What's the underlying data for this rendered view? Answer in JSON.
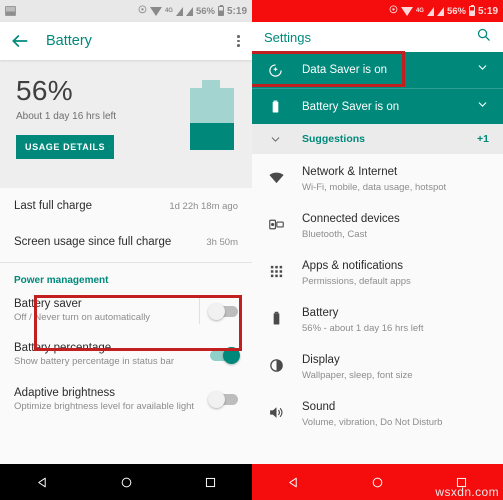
{
  "colors": {
    "teal": "#00897a",
    "teal_light": "#a4d4d0",
    "status_red": "#f50c0c",
    "annotation_red": "#c21f20"
  },
  "left_screen": {
    "statusbar": {
      "icons": [
        "screenshot-icon",
        "dnd-icon",
        "wifi-icon",
        "4g-label",
        "signal-icon",
        "signal-icon"
      ],
      "network_label": "4G",
      "battery_percent": "56%",
      "clock": "5:19"
    },
    "appbar": {
      "back_icon": "back-arrow-icon",
      "title": "Battery",
      "overflow_icon": "kebab-menu-icon"
    },
    "hero": {
      "percent": "56%",
      "estimate": "About 1 day 16 hrs left",
      "button_label": "USAGE DETAILS",
      "battery_fill_percent": 44
    },
    "rows": [
      {
        "title": "Last full charge",
        "value": "1d 22h 18m ago"
      },
      {
        "title": "Screen usage since full charge",
        "value": "3h 50m"
      }
    ],
    "section_title": "Power management",
    "settings": [
      {
        "title": "Battery saver",
        "subtitle": "Off / Never turn on automatically",
        "toggle": "off",
        "highlighted": true
      },
      {
        "title": "Battery percentage",
        "subtitle": "Show battery percentage in status bar",
        "toggle": "on",
        "highlighted": false
      },
      {
        "title": "Adaptive brightness",
        "subtitle": "Optimize brightness level for available light",
        "toggle": "off",
        "highlighted": false
      }
    ],
    "navbar": {
      "back": "back-triangle-icon",
      "home": "home-circle-icon",
      "recents": "recents-square-icon"
    }
  },
  "right_screen": {
    "statusbar": {
      "network_label": "4G",
      "battery_percent": "56%",
      "clock": "5:19"
    },
    "appbar": {
      "title": "Settings",
      "search_icon": "search-icon"
    },
    "banners": [
      {
        "icon": "data-saver-icon",
        "label": "Data Saver is on",
        "chevron": "chevron-down-icon",
        "highlighted": true
      },
      {
        "icon": "battery-icon",
        "label": "Battery Saver is on",
        "chevron": "chevron-down-icon",
        "highlighted": false
      }
    ],
    "suggestions": {
      "chevron": "chevron-down-icon",
      "label": "Suggestions",
      "count": "+1"
    },
    "items": [
      {
        "icon": "wifi-icon",
        "title": "Network & Internet",
        "subtitle": "Wi-Fi, mobile, data usage, hotspot"
      },
      {
        "icon": "connected-devices-icon",
        "title": "Connected devices",
        "subtitle": "Bluetooth, Cast"
      },
      {
        "icon": "apps-grid-icon",
        "title": "Apps & notifications",
        "subtitle": "Permissions, default apps"
      },
      {
        "icon": "battery-icon",
        "title": "Battery",
        "subtitle": "56% - about 1 day 16 hrs left"
      },
      {
        "icon": "brightness-icon",
        "title": "Display",
        "subtitle": "Wallpaper, sleep, font size"
      },
      {
        "icon": "sound-icon",
        "title": "Sound",
        "subtitle": "Volume, vibration, Do Not Disturb"
      }
    ],
    "navbar": {
      "back": "back-triangle-icon",
      "home": "home-circle-icon",
      "recents": "recents-square-icon"
    },
    "watermark": "wsxdn.com"
  }
}
